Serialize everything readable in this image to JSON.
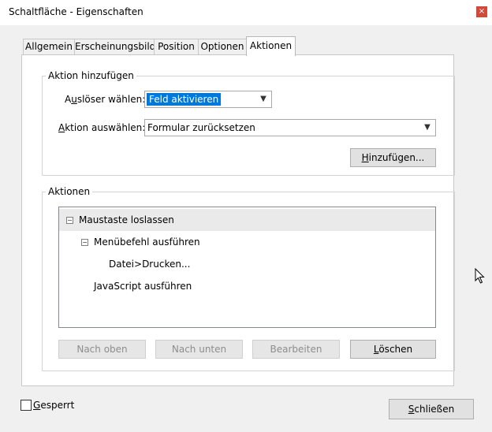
{
  "window": {
    "title": "Schaltfläche - Eigenschaften",
    "close_glyph": "×"
  },
  "tabs": [
    {
      "label": "Allgemein"
    },
    {
      "label": "Erscheinungsbild"
    },
    {
      "label": "Position"
    },
    {
      "label": "Optionen"
    },
    {
      "label": "Aktionen",
      "active": true
    }
  ],
  "add_action": {
    "group_title": "Aktion hinzufügen",
    "trigger_label_pre": "A",
    "trigger_label_u": "u",
    "trigger_label_post": "slöser wählen:",
    "trigger_value": "Feld aktivieren",
    "action_label_pre": "",
    "action_label_u": "A",
    "action_label_post": "ktion auswählen:",
    "action_value": "Formular zurücksetzen",
    "add_button_u": "H",
    "add_button_post": "inzufügen..."
  },
  "actions": {
    "group_title": "Aktionen",
    "tree": [
      {
        "label": "Maustaste loslassen",
        "expander": "⊟"
      },
      {
        "label": "Menübefehl ausführen",
        "expander": "⊟"
      },
      {
        "label": "Datei>Drucken..."
      },
      {
        "label": "JavaScript ausführen"
      }
    ],
    "buttons": {
      "up": "Nach oben",
      "down": "Nach unten",
      "edit": "Bearbeiten",
      "delete_u": "L",
      "delete_post": "öschen"
    }
  },
  "locked": {
    "label_u": "G",
    "label_post": "esperrt",
    "checked": false
  },
  "close_button": {
    "u": "S",
    "post": "chließen"
  }
}
